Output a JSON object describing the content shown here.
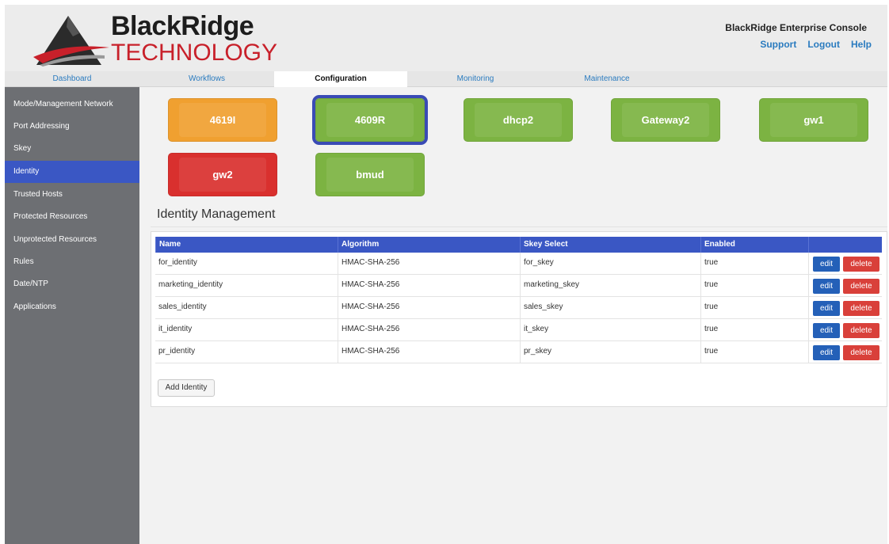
{
  "header": {
    "logo_line1": "BlackRidge",
    "logo_line2": "TECHNOLOGY",
    "console_title": "BlackRidge Enterprise Console",
    "links": [
      "Support",
      "Logout",
      "Help"
    ]
  },
  "tabs": [
    {
      "label": "Dashboard",
      "active": false
    },
    {
      "label": "Workflows",
      "active": false
    },
    {
      "label": "Configuration",
      "active": true
    },
    {
      "label": "Monitoring",
      "active": false
    },
    {
      "label": "Maintenance",
      "active": false
    }
  ],
  "sidebar": {
    "items": [
      {
        "label": "Mode/Management Network"
      },
      {
        "label": "Port Addressing"
      },
      {
        "label": "Skey"
      },
      {
        "label": "Identity",
        "active": true
      },
      {
        "label": "Trusted Hosts"
      },
      {
        "label": "Protected Resources"
      },
      {
        "label": "Unprotected Resources"
      },
      {
        "label": "Rules"
      },
      {
        "label": "Date/NTP"
      },
      {
        "label": "Applications"
      }
    ]
  },
  "devices": [
    {
      "label": "4619I",
      "status_color": "#f0a030"
    },
    {
      "label": "4609R",
      "status_color": "#7cb342",
      "selected": true
    },
    {
      "label": "dhcp2",
      "status_color": "#7cb342"
    },
    {
      "label": "Gateway2",
      "status_color": "#7cb342"
    },
    {
      "label": "gw1",
      "status_color": "#7cb342"
    },
    {
      "label": "gw2",
      "status_color": "#d9302e"
    },
    {
      "label": "bmud",
      "status_color": "#7cb342"
    }
  ],
  "section": {
    "title": "Identity Management"
  },
  "table": {
    "columns": [
      "Name",
      "Algorithm",
      "Skey Select",
      "Enabled",
      ""
    ],
    "rows": [
      {
        "name": "for_identity",
        "algorithm": "HMAC-SHA-256",
        "skey": "for_skey",
        "enabled": "true"
      },
      {
        "name": "marketing_identity",
        "algorithm": "HMAC-SHA-256",
        "skey": "marketing_skey",
        "enabled": "true"
      },
      {
        "name": "sales_identity",
        "algorithm": "HMAC-SHA-256",
        "skey": "sales_skey",
        "enabled": "true"
      },
      {
        "name": "it_identity",
        "algorithm": "HMAC-SHA-256",
        "skey": "it_skey",
        "enabled": "true"
      },
      {
        "name": "pr_identity",
        "algorithm": "HMAC-SHA-256",
        "skey": "pr_skey",
        "enabled": "true"
      }
    ],
    "edit_label": "edit",
    "delete_label": "delete"
  },
  "add_button_label": "Add Identity",
  "colors": {
    "accent": "#3a57c4",
    "link": "#2a7bbf",
    "edit": "#2460b8",
    "delete": "#d9403a"
  }
}
